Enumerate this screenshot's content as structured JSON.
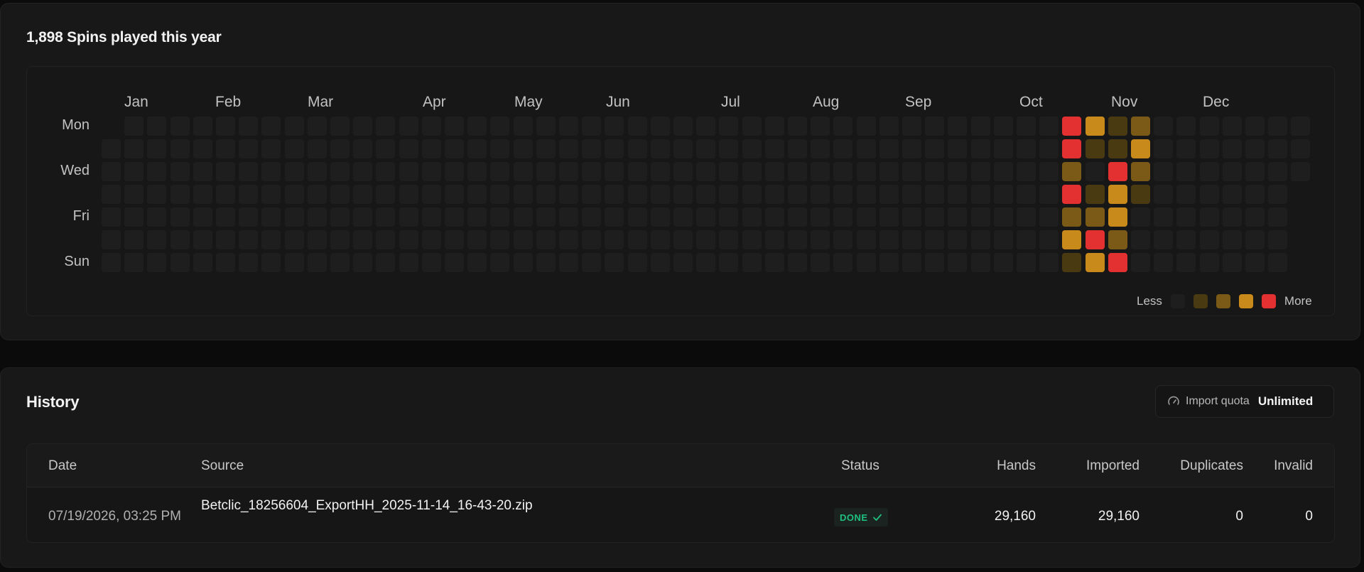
{
  "activity": {
    "title": "1,898 Spins played this year",
    "months": [
      "Jan",
      "Feb",
      "Mar",
      "Apr",
      "May",
      "Jun",
      "Jul",
      "Aug",
      "Sep",
      "Oct",
      "Nov",
      "Dec"
    ],
    "days": [
      "Mon",
      "Wed",
      "Fri",
      "Sun"
    ],
    "legend": {
      "less": "Less",
      "more": "More"
    },
    "colors": {
      "level0": "#1e1e1e",
      "level1": "#4a3a12",
      "level2": "#7a5a16",
      "level3": "#c88a1a",
      "level4": "#e33131"
    },
    "weeks": 53,
    "active_cells": [
      {
        "week": 42,
        "day": 0,
        "level": 4
      },
      {
        "week": 42,
        "day": 1,
        "level": 4
      },
      {
        "week": 42,
        "day": 2,
        "level": 2
      },
      {
        "week": 42,
        "day": 3,
        "level": 4
      },
      {
        "week": 42,
        "day": 4,
        "level": 2
      },
      {
        "week": 42,
        "day": 5,
        "level": 3
      },
      {
        "week": 42,
        "day": 6,
        "level": 1
      },
      {
        "week": 43,
        "day": 0,
        "level": 3
      },
      {
        "week": 43,
        "day": 1,
        "level": 1
      },
      {
        "week": 43,
        "day": 2,
        "level": 0
      },
      {
        "week": 43,
        "day": 3,
        "level": 1
      },
      {
        "week": 43,
        "day": 4,
        "level": 2
      },
      {
        "week": 43,
        "day": 5,
        "level": 4
      },
      {
        "week": 43,
        "day": 6,
        "level": 3
      },
      {
        "week": 44,
        "day": 0,
        "level": 1
      },
      {
        "week": 44,
        "day": 1,
        "level": 1
      },
      {
        "week": 44,
        "day": 2,
        "level": 4
      },
      {
        "week": 44,
        "day": 3,
        "level": 3
      },
      {
        "week": 44,
        "day": 4,
        "level": 3
      },
      {
        "week": 44,
        "day": 5,
        "level": 2
      },
      {
        "week": 44,
        "day": 6,
        "level": 4
      },
      {
        "week": 45,
        "day": 0,
        "level": 2
      },
      {
        "week": 45,
        "day": 1,
        "level": 3
      },
      {
        "week": 45,
        "day": 2,
        "level": 2
      },
      {
        "week": 45,
        "day": 3,
        "level": 1
      }
    ]
  },
  "history": {
    "title": "History",
    "quota": {
      "label": "Import quota",
      "value": "Unlimited",
      "icon": "gauge-icon"
    },
    "columns": [
      "Date",
      "Source",
      "Status",
      "Hands",
      "Imported",
      "Duplicates",
      "Invalid"
    ],
    "rows": [
      {
        "date": "07/19/2026, 03:25 PM",
        "source": "Betclic_18256604_ExportHH_2025-11-14_16-43-20.zip",
        "status": "DONE",
        "hands": "29,160",
        "imported": "29,160",
        "duplicates": "0",
        "invalid": "0"
      }
    ]
  }
}
